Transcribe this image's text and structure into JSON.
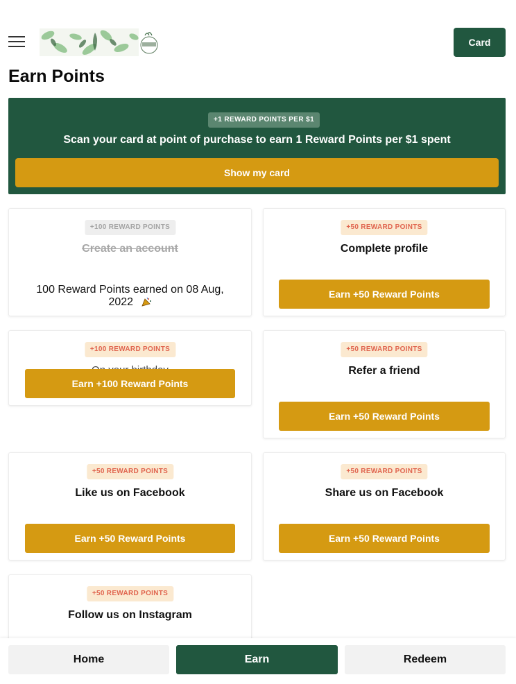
{
  "header": {
    "menu_icon": "hamburger-menu-icon",
    "logo": "wild-pear-logo",
    "card_label": "Card"
  },
  "page": {
    "title": "Earn Points"
  },
  "banner": {
    "badge": "+1 REWARD POINTS PER $1",
    "text": "Scan your card at point of purchase to earn 1 Reward Points per $1 spent",
    "button": "Show my card"
  },
  "tiles": [
    {
      "badge": "+100 REWARD POINTS",
      "title": "Create an account",
      "earned": "100 Reward Points earned on 08 Aug, 2022",
      "earned_icon": "party-popper-icon"
    },
    {
      "badge": "+50 REWARD POINTS",
      "title": "Complete profile",
      "button": "Earn +50 Reward Points"
    },
    {
      "badge": "+100 REWARD POINTS",
      "title": "On your birthday",
      "button": "Earn +100 Reward Points"
    },
    {
      "badge": "+50 REWARD POINTS",
      "title": "Refer a friend",
      "button": "Earn +50 Reward Points"
    },
    {
      "badge": "+50 REWARD POINTS",
      "title": "Like us on Facebook",
      "button": "Earn +50 Reward Points"
    },
    {
      "badge": "+50 REWARD POINTS",
      "title": "Share us on Facebook",
      "button": "Earn +50 Reward Points"
    },
    {
      "badge": "+50 REWARD POINTS",
      "title": "Follow us on Instagram"
    }
  ],
  "nav": {
    "home": "Home",
    "earn": "Earn",
    "redeem": "Redeem"
  },
  "colors": {
    "brand_green": "#21573f",
    "accent_gold": "#d59a12",
    "badge_text": "#e0654f",
    "badge_bg": "#fbe9d0"
  }
}
